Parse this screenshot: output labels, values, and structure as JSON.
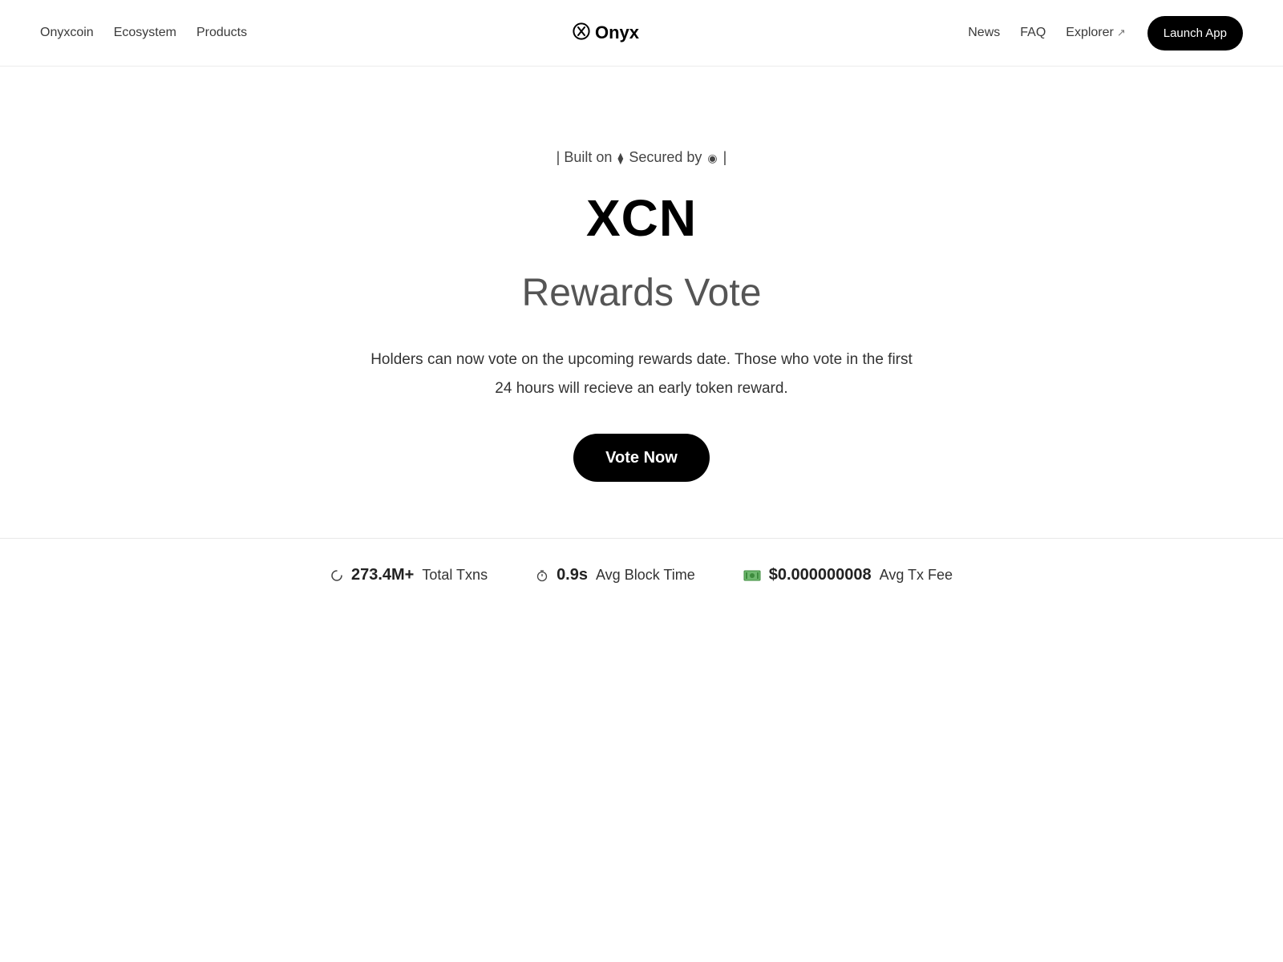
{
  "nav": {
    "left": [
      "Onyxcoin",
      "Ecosystem",
      "Products"
    ],
    "brand": "Onyx",
    "right": [
      "News",
      "FAQ",
      "Explorer"
    ],
    "launch_label": "Launch App"
  },
  "hero": {
    "tagline_pre": "| Built on",
    "tagline_mid": "Secured by",
    "tagline_post": "|",
    "ticker": "XCN",
    "title": "Rewards Vote",
    "description": "Holders can now vote on the upcoming rewards date. Those who vote in the first 24 hours will recieve an early token reward.",
    "cta_label": "Vote Now"
  },
  "stats": [
    {
      "icon": "refresh-icon",
      "value": "273.4M+",
      "label": "Total Txns"
    },
    {
      "icon": "stopwatch-icon",
      "value": "0.9s",
      "label": "Avg Block Time"
    },
    {
      "icon": "money-icon",
      "value": "$0.000000008",
      "label": "Avg Tx Fee"
    }
  ],
  "colors": {
    "accent": "#000000",
    "text": "#333333",
    "muted": "#555555",
    "divider": "#e8e8e8"
  }
}
